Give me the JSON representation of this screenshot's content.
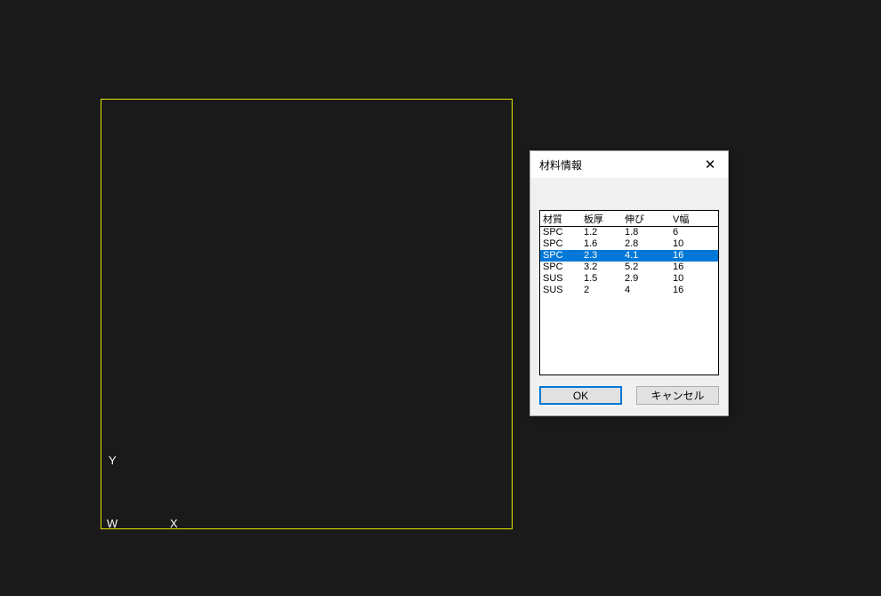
{
  "axes": {
    "y": "Y",
    "w": "W",
    "x": "X"
  },
  "dialog": {
    "title": "材料情報",
    "close": "✕",
    "headers": [
      "材質",
      "板厚",
      "伸び",
      "V幅"
    ],
    "rows": [
      {
        "cells": [
          "SPC",
          "1.2",
          "1.8",
          "6"
        ],
        "selected": false
      },
      {
        "cells": [
          "SPC",
          "1.6",
          "2.8",
          "10"
        ],
        "selected": false
      },
      {
        "cells": [
          "SPC",
          "2.3",
          "4.1",
          "16"
        ],
        "selected": true
      },
      {
        "cells": [
          "SPC",
          "3.2",
          "5.2",
          "16"
        ],
        "selected": false
      },
      {
        "cells": [
          "SUS",
          "1.5",
          "2.9",
          "10"
        ],
        "selected": false
      },
      {
        "cells": [
          "SUS",
          "2",
          "4",
          "16"
        ],
        "selected": false
      }
    ],
    "ok": "OK",
    "cancel": "キャンセル"
  }
}
